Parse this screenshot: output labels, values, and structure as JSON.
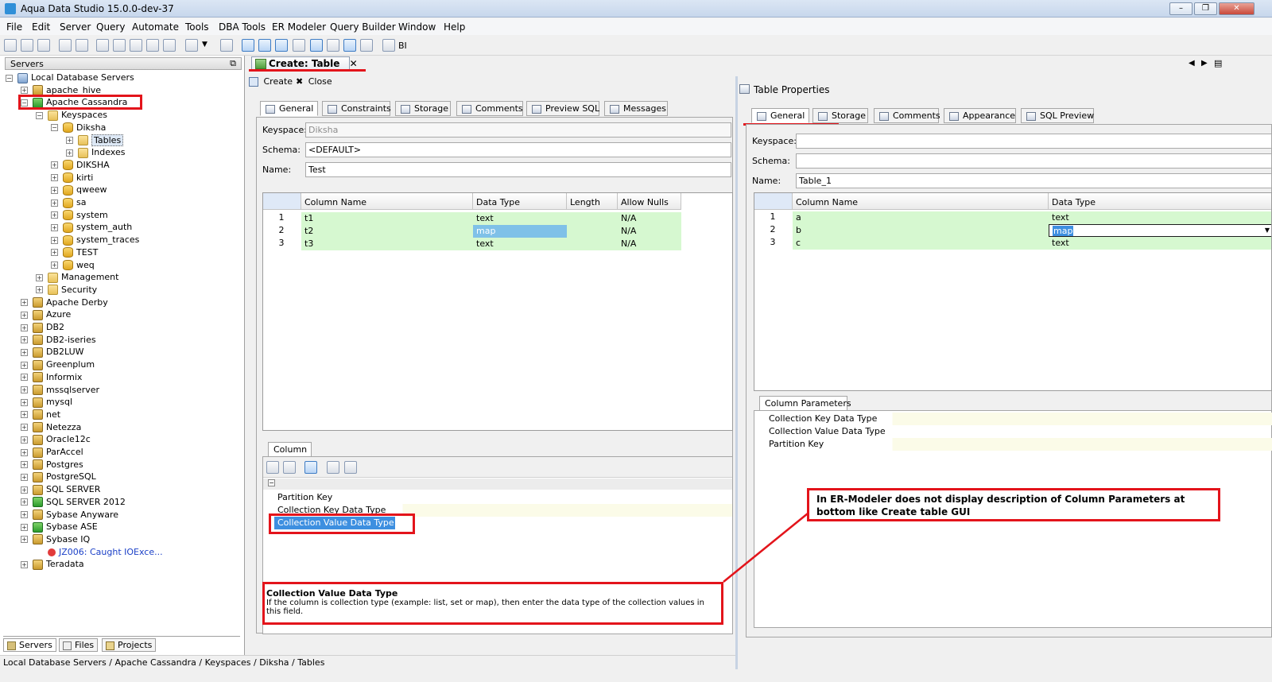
{
  "window": {
    "title": "Aqua Data Studio 15.0.0-dev-37",
    "minimize": "–",
    "maximize": "❐",
    "close": "✕"
  },
  "menu": [
    "File",
    "Edit",
    "Server",
    "Query",
    "Automate",
    "Tools",
    "DBA Tools",
    "ER Modeler",
    "Query Builder",
    "Window",
    "Help"
  ],
  "toolbar": {
    "bi_label": "BI"
  },
  "servers_panel": {
    "title": "Servers",
    "tree": [
      {
        "label": "Local Database Servers",
        "level": 0,
        "icon": "server-group-icon"
      },
      {
        "label": "apache_hive",
        "level": 1,
        "icon": "server-icon"
      },
      {
        "label": "Apache Cassandra",
        "level": 1,
        "icon": "server-icon"
      },
      {
        "label": "Keyspaces",
        "level": 2,
        "icon": "folder-icon"
      },
      {
        "label": "Diksha",
        "level": 3,
        "icon": "database-icon"
      },
      {
        "label": "Tables",
        "level": 4,
        "icon": "folder-icon"
      },
      {
        "label": "Indexes",
        "level": 4,
        "icon": "folder-icon"
      },
      {
        "label": "DIKSHA",
        "level": 3,
        "icon": "database-icon"
      },
      {
        "label": "kirti",
        "level": 3,
        "icon": "database-icon"
      },
      {
        "label": "qweew",
        "level": 3,
        "icon": "database-icon"
      },
      {
        "label": "sa",
        "level": 3,
        "icon": "database-icon"
      },
      {
        "label": "system",
        "level": 3,
        "icon": "database-icon"
      },
      {
        "label": "system_auth",
        "level": 3,
        "icon": "database-icon"
      },
      {
        "label": "system_traces",
        "level": 3,
        "icon": "database-icon"
      },
      {
        "label": "TEST",
        "level": 3,
        "icon": "database-icon"
      },
      {
        "label": "weq",
        "level": 3,
        "icon": "database-icon"
      },
      {
        "label": "Management",
        "level": 2,
        "icon": "folder-icon"
      },
      {
        "label": "Security",
        "level": 2,
        "icon": "folder-icon"
      },
      {
        "label": "Apache Derby",
        "level": 1,
        "icon": "server-icon"
      },
      {
        "label": "Azure",
        "level": 1,
        "icon": "server-icon"
      },
      {
        "label": "DB2",
        "level": 1,
        "icon": "server-icon"
      },
      {
        "label": "DB2-iseries",
        "level": 1,
        "icon": "server-icon"
      },
      {
        "label": "DB2LUW",
        "level": 1,
        "icon": "server-icon"
      },
      {
        "label": "Greenplum",
        "level": 1,
        "icon": "server-icon"
      },
      {
        "label": "Informix",
        "level": 1,
        "icon": "server-icon"
      },
      {
        "label": "mssqlserver",
        "level": 1,
        "icon": "server-icon"
      },
      {
        "label": "mysql",
        "level": 1,
        "icon": "server-icon"
      },
      {
        "label": "net",
        "level": 1,
        "icon": "server-icon"
      },
      {
        "label": "Netezza",
        "level": 1,
        "icon": "server-icon"
      },
      {
        "label": "Oracle12c",
        "level": 1,
        "icon": "server-icon"
      },
      {
        "label": "ParAccel",
        "level": 1,
        "icon": "server-icon"
      },
      {
        "label": "Postgres",
        "level": 1,
        "icon": "server-icon"
      },
      {
        "label": "PostgreSQL",
        "level": 1,
        "icon": "server-icon"
      },
      {
        "label": "SQL SERVER",
        "level": 1,
        "icon": "server-icon"
      },
      {
        "label": "SQL SERVER 2012",
        "level": 1,
        "icon": "server-icon"
      },
      {
        "label": "Sybase Anyware",
        "level": 1,
        "icon": "server-icon"
      },
      {
        "label": "Sybase ASE",
        "level": 1,
        "icon": "server-icon"
      },
      {
        "label": "Sybase IQ",
        "level": 1,
        "icon": "server-icon"
      },
      {
        "label": "JZ006: Caught IOExce...",
        "level": 2,
        "icon": "error-icon"
      },
      {
        "label": "Teradata",
        "level": 1,
        "icon": "server-icon"
      }
    ],
    "bottom_tabs": [
      "Servers",
      "Files",
      "Projects"
    ]
  },
  "status_bar": "Local Database Servers / Apache Cassandra / Keyspaces / Diksha / Tables",
  "editor": {
    "tab_title": "Create: Table",
    "tab_close": "✕",
    "actions": {
      "create": "Create",
      "close": "Close"
    },
    "tabs": [
      "General",
      "Constraints",
      "Storage",
      "Comments",
      "Preview SQL",
      "Messages"
    ],
    "keyspace_label": "Keyspace:",
    "keyspace_value": "Diksha",
    "schema_label": "Schema:",
    "schema_value": "<DEFAULT>",
    "name_label": "Name:",
    "name_value": "Test",
    "columns": {
      "headers": [
        "Column Name",
        "Data Type",
        "Length",
        "Allow Nulls"
      ],
      "rows": [
        {
          "num": "1",
          "name": "t1",
          "type": "text",
          "length": "",
          "nulls": "N/A"
        },
        {
          "num": "2",
          "name": "t2",
          "type": "map",
          "length": "",
          "nulls": "N/A"
        },
        {
          "num": "3",
          "name": "t3",
          "type": "text",
          "length": "",
          "nulls": "N/A"
        }
      ]
    },
    "column_tab": "Column",
    "column_props": [
      "Partition Key",
      "Collection Key Data Type",
      "Collection Value Data Type"
    ],
    "description": {
      "title": "Collection Value Data Type",
      "text": "If the column is collection type (example: list, set or map), then enter the data type of the collection values in this field."
    }
  },
  "table_properties": {
    "title": "Table Properties",
    "tabs": [
      "General",
      "Storage",
      "Comments",
      "Appearance",
      "SQL Preview"
    ],
    "keyspace_label": "Keyspace:",
    "keyspace_value": "",
    "schema_label": "Schema:",
    "schema_value": "",
    "name_label": "Name:",
    "name_value": "Table_1",
    "columns": {
      "headers": [
        "Column Name",
        "Data Type"
      ],
      "rows": [
        {
          "num": "1",
          "name": "a",
          "type": "text"
        },
        {
          "num": "2",
          "name": "b",
          "type": "map"
        },
        {
          "num": "3",
          "name": "c",
          "type": "text"
        }
      ]
    },
    "params_tab": "Column Parameters",
    "params": [
      "Collection Key Data Type",
      "Collection Value Data Type",
      "Partition Key"
    ]
  },
  "annotation": "In ER-Modeler does not display description of Column Parameters at bottom  like Create table GUI",
  "colors": {
    "highlight_red": "#e3141b",
    "grid_green": "#d6f8d0",
    "selection_blue": "#7fc1e8"
  }
}
